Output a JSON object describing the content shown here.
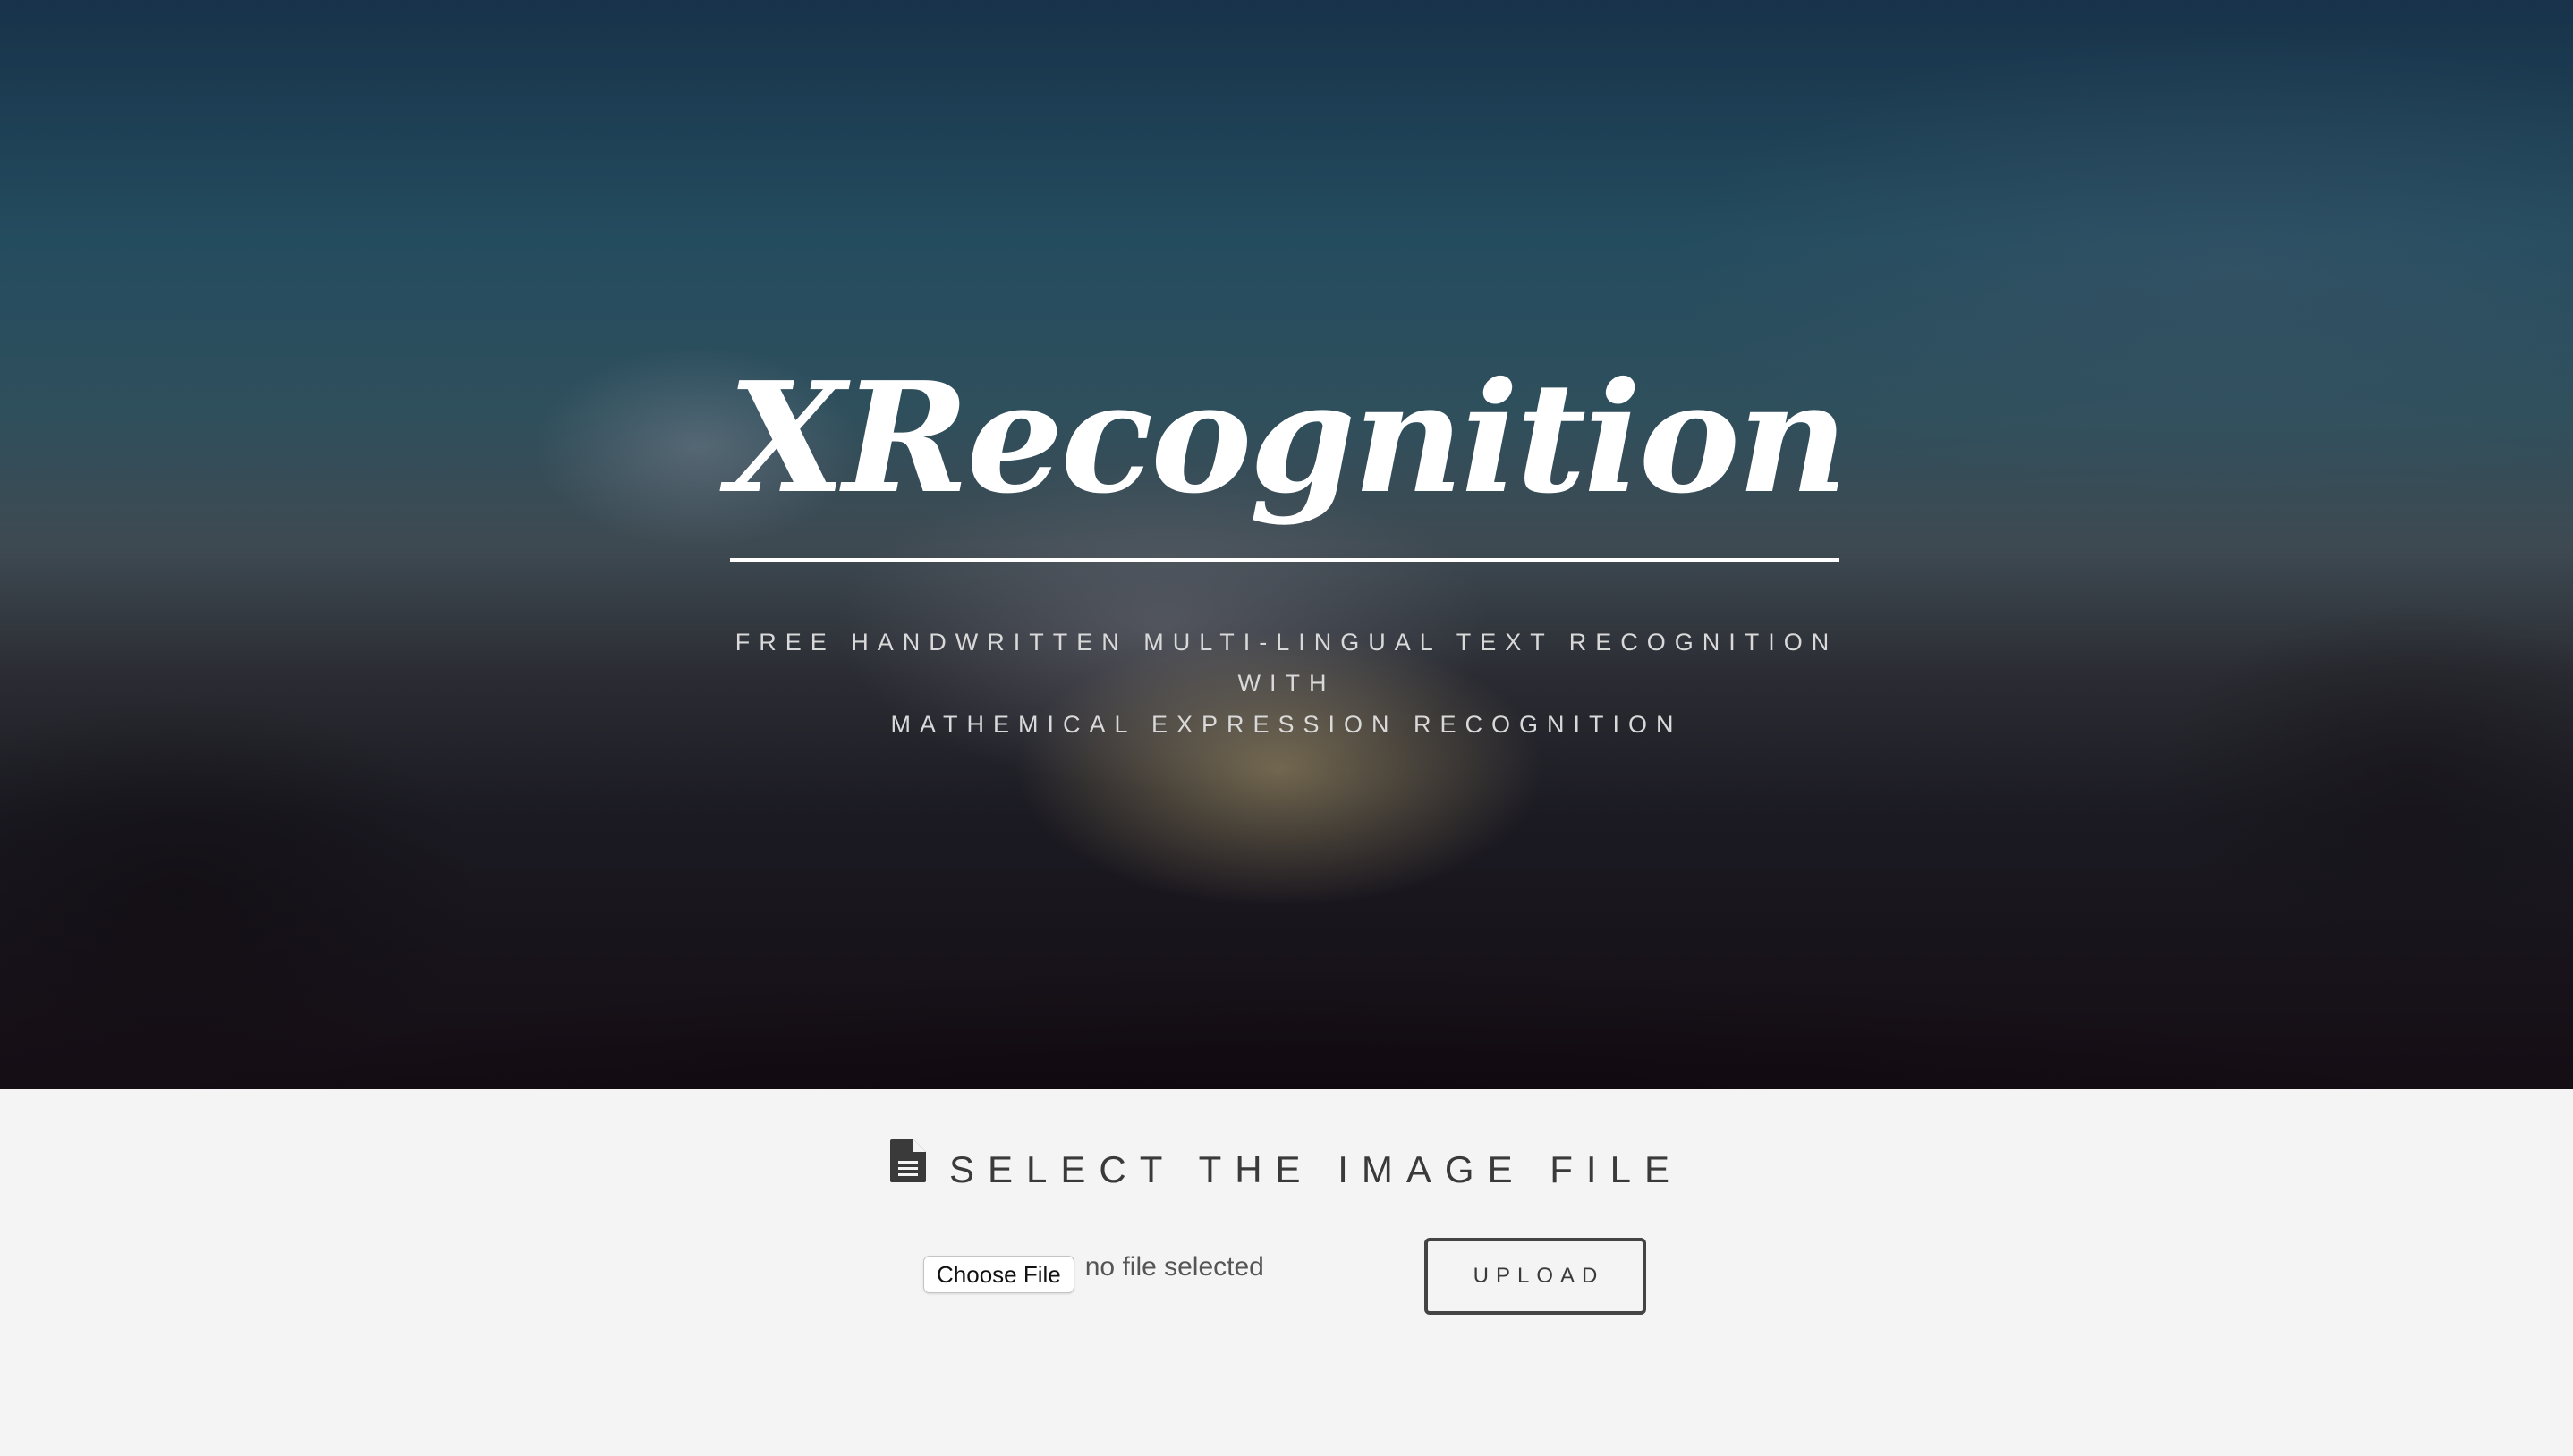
{
  "hero": {
    "title": "XRecognition",
    "tagline_lines": [
      "FREE HANDWRITTEN MULTI-LINGUAL TEXT RECOGNITION",
      "WITH",
      "MATHEMICAL EXPRESSION RECOGNITION"
    ]
  },
  "upload": {
    "heading": "SELECT THE IMAGE FILE",
    "heading_icon": "file-text-icon",
    "choose_file_label": "Choose File",
    "no_file_text": "no file selected",
    "upload_label": "UPLOAD"
  },
  "colors": {
    "hero_text": "#ffffff",
    "tagline_text": "#d9d9d9",
    "section_background": "#f4f4f4",
    "section_text": "#3a3a3a"
  }
}
